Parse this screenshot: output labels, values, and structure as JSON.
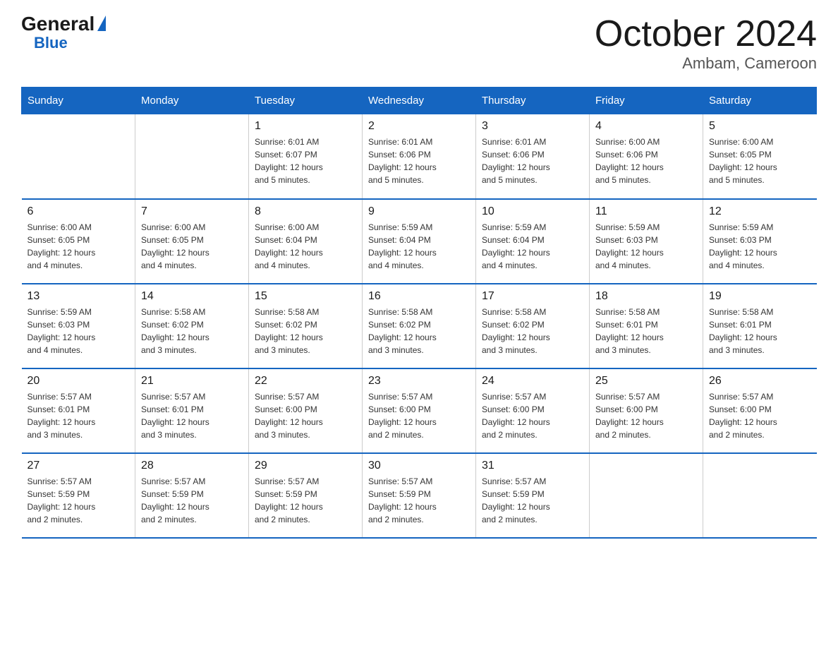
{
  "logo": {
    "general": "General",
    "blue": "Blue",
    "triangle": "▶"
  },
  "title": "October 2024",
  "subtitle": "Ambam, Cameroon",
  "days_of_week": [
    "Sunday",
    "Monday",
    "Tuesday",
    "Wednesday",
    "Thursday",
    "Friday",
    "Saturday"
  ],
  "weeks": [
    [
      {
        "day": "",
        "info": ""
      },
      {
        "day": "",
        "info": ""
      },
      {
        "day": "1",
        "info": "Sunrise: 6:01 AM\nSunset: 6:07 PM\nDaylight: 12 hours\nand 5 minutes."
      },
      {
        "day": "2",
        "info": "Sunrise: 6:01 AM\nSunset: 6:06 PM\nDaylight: 12 hours\nand 5 minutes."
      },
      {
        "day": "3",
        "info": "Sunrise: 6:01 AM\nSunset: 6:06 PM\nDaylight: 12 hours\nand 5 minutes."
      },
      {
        "day": "4",
        "info": "Sunrise: 6:00 AM\nSunset: 6:06 PM\nDaylight: 12 hours\nand 5 minutes."
      },
      {
        "day": "5",
        "info": "Sunrise: 6:00 AM\nSunset: 6:05 PM\nDaylight: 12 hours\nand 5 minutes."
      }
    ],
    [
      {
        "day": "6",
        "info": "Sunrise: 6:00 AM\nSunset: 6:05 PM\nDaylight: 12 hours\nand 4 minutes."
      },
      {
        "day": "7",
        "info": "Sunrise: 6:00 AM\nSunset: 6:05 PM\nDaylight: 12 hours\nand 4 minutes."
      },
      {
        "day": "8",
        "info": "Sunrise: 6:00 AM\nSunset: 6:04 PM\nDaylight: 12 hours\nand 4 minutes."
      },
      {
        "day": "9",
        "info": "Sunrise: 5:59 AM\nSunset: 6:04 PM\nDaylight: 12 hours\nand 4 minutes."
      },
      {
        "day": "10",
        "info": "Sunrise: 5:59 AM\nSunset: 6:04 PM\nDaylight: 12 hours\nand 4 minutes."
      },
      {
        "day": "11",
        "info": "Sunrise: 5:59 AM\nSunset: 6:03 PM\nDaylight: 12 hours\nand 4 minutes."
      },
      {
        "day": "12",
        "info": "Sunrise: 5:59 AM\nSunset: 6:03 PM\nDaylight: 12 hours\nand 4 minutes."
      }
    ],
    [
      {
        "day": "13",
        "info": "Sunrise: 5:59 AM\nSunset: 6:03 PM\nDaylight: 12 hours\nand 4 minutes."
      },
      {
        "day": "14",
        "info": "Sunrise: 5:58 AM\nSunset: 6:02 PM\nDaylight: 12 hours\nand 3 minutes."
      },
      {
        "day": "15",
        "info": "Sunrise: 5:58 AM\nSunset: 6:02 PM\nDaylight: 12 hours\nand 3 minutes."
      },
      {
        "day": "16",
        "info": "Sunrise: 5:58 AM\nSunset: 6:02 PM\nDaylight: 12 hours\nand 3 minutes."
      },
      {
        "day": "17",
        "info": "Sunrise: 5:58 AM\nSunset: 6:02 PM\nDaylight: 12 hours\nand 3 minutes."
      },
      {
        "day": "18",
        "info": "Sunrise: 5:58 AM\nSunset: 6:01 PM\nDaylight: 12 hours\nand 3 minutes."
      },
      {
        "day": "19",
        "info": "Sunrise: 5:58 AM\nSunset: 6:01 PM\nDaylight: 12 hours\nand 3 minutes."
      }
    ],
    [
      {
        "day": "20",
        "info": "Sunrise: 5:57 AM\nSunset: 6:01 PM\nDaylight: 12 hours\nand 3 minutes."
      },
      {
        "day": "21",
        "info": "Sunrise: 5:57 AM\nSunset: 6:01 PM\nDaylight: 12 hours\nand 3 minutes."
      },
      {
        "day": "22",
        "info": "Sunrise: 5:57 AM\nSunset: 6:00 PM\nDaylight: 12 hours\nand 3 minutes."
      },
      {
        "day": "23",
        "info": "Sunrise: 5:57 AM\nSunset: 6:00 PM\nDaylight: 12 hours\nand 2 minutes."
      },
      {
        "day": "24",
        "info": "Sunrise: 5:57 AM\nSunset: 6:00 PM\nDaylight: 12 hours\nand 2 minutes."
      },
      {
        "day": "25",
        "info": "Sunrise: 5:57 AM\nSunset: 6:00 PM\nDaylight: 12 hours\nand 2 minutes."
      },
      {
        "day": "26",
        "info": "Sunrise: 5:57 AM\nSunset: 6:00 PM\nDaylight: 12 hours\nand 2 minutes."
      }
    ],
    [
      {
        "day": "27",
        "info": "Sunrise: 5:57 AM\nSunset: 5:59 PM\nDaylight: 12 hours\nand 2 minutes."
      },
      {
        "day": "28",
        "info": "Sunrise: 5:57 AM\nSunset: 5:59 PM\nDaylight: 12 hours\nand 2 minutes."
      },
      {
        "day": "29",
        "info": "Sunrise: 5:57 AM\nSunset: 5:59 PM\nDaylight: 12 hours\nand 2 minutes."
      },
      {
        "day": "30",
        "info": "Sunrise: 5:57 AM\nSunset: 5:59 PM\nDaylight: 12 hours\nand 2 minutes."
      },
      {
        "day": "31",
        "info": "Sunrise: 5:57 AM\nSunset: 5:59 PM\nDaylight: 12 hours\nand 2 minutes."
      },
      {
        "day": "",
        "info": ""
      },
      {
        "day": "",
        "info": ""
      }
    ]
  ]
}
